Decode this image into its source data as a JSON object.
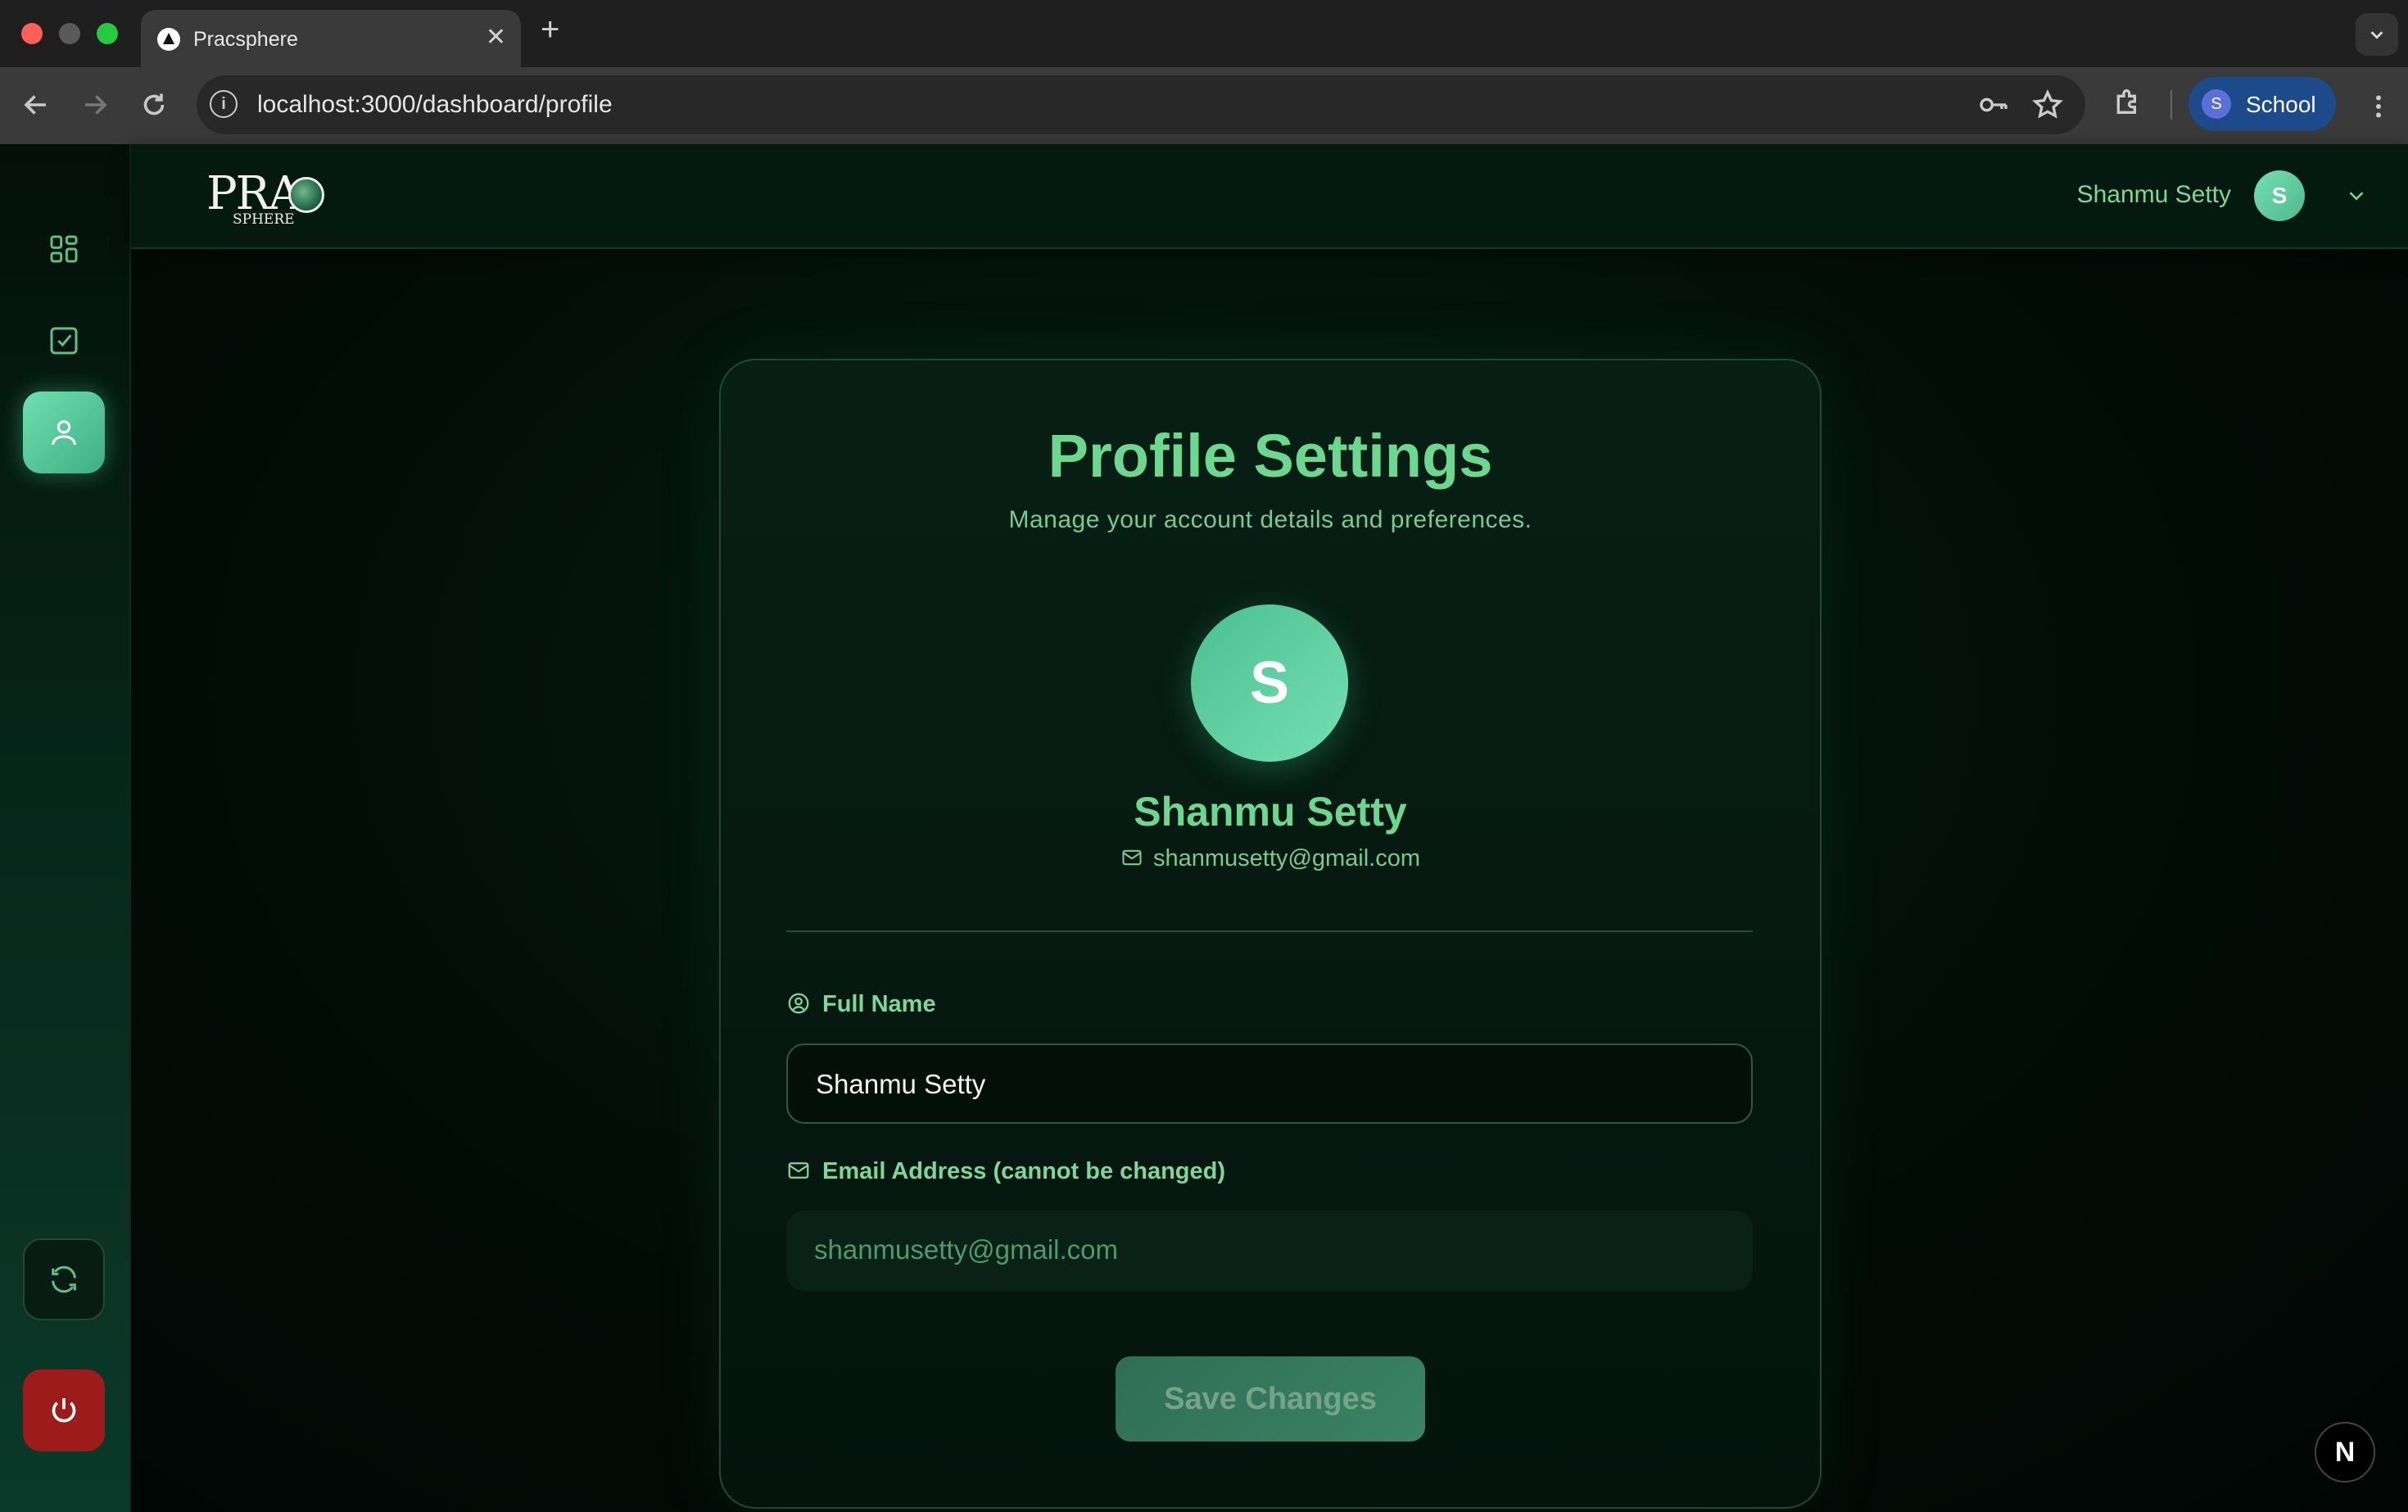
{
  "browser": {
    "tab_title": "Pracsphere",
    "tab_close": "✕",
    "new_tab": "+",
    "url": "localhost:3000/dashboard/profile",
    "profile_initial": "S",
    "profile_name": "School"
  },
  "header": {
    "logo_main": "PRA",
    "logo_sub": "SPHERE",
    "user_name": "Shanmu Setty",
    "user_initial": "S"
  },
  "profile": {
    "title": "Profile Settings",
    "subtitle": "Manage your account details and preferences.",
    "avatar_initial": "S",
    "name": "Shanmu Setty",
    "email": "shanmusetty@gmail.com"
  },
  "form": {
    "full_name_label": "Full Name",
    "full_name_value": "Shanmu Setty",
    "email_label": "Email Address (cannot be changed)",
    "email_value": "shanmusetty@gmail.com",
    "save_label": "Save Changes"
  },
  "dev_badge": "N",
  "colors": {
    "accent": "#6dd68f",
    "avatar_gradient_start": "#4cc08f",
    "avatar_gradient_end": "#74dfb4",
    "logout": "#9c1b1b"
  },
  "icons": {
    "sidebar": [
      "dashboard-grid-icon",
      "task-check-icon",
      "user-icon",
      "refresh-icon",
      "power-icon"
    ]
  }
}
